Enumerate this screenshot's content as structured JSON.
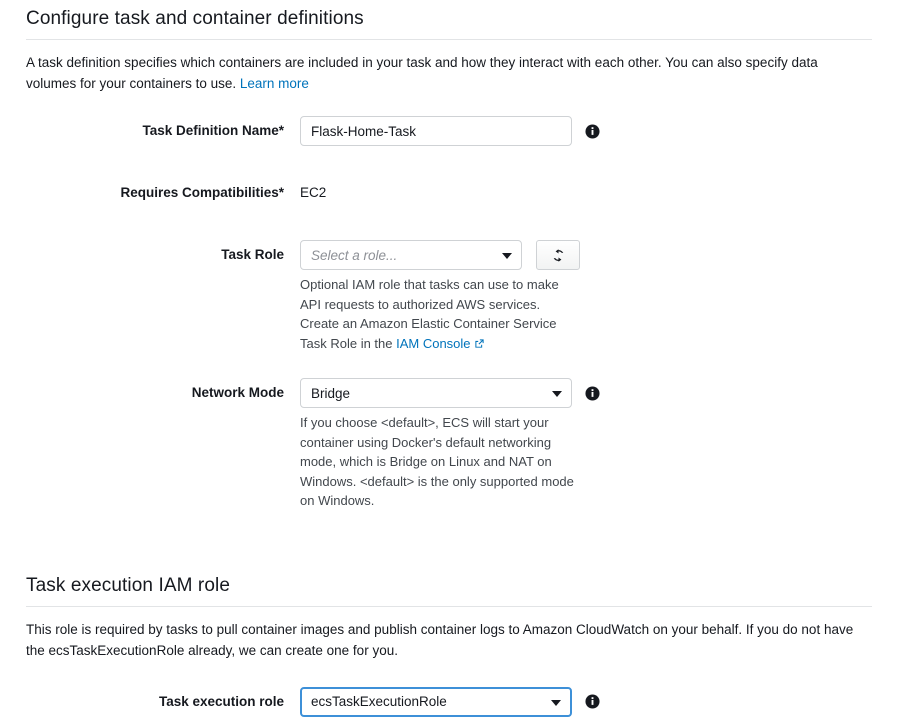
{
  "sections": [
    {
      "id": "configure",
      "title": "Configure task and container definitions",
      "description_before_link": "A task definition specifies which containers are included in your task and how they interact with each other. You can also specify data volumes for your containers to use. ",
      "link_label": "Learn more"
    },
    {
      "id": "execution-role",
      "title": "Task execution IAM role",
      "description": "This role is required by tasks to pull container images and publish container logs to Amazon CloudWatch on your behalf. If you do not have the ecsTaskExecutionRole already, we can create one for you."
    }
  ],
  "fields": {
    "task_definition_name": {
      "label": "Task Definition Name*",
      "value": "Flask-Home-Task",
      "placeholder": ""
    },
    "requires_compatibilities": {
      "label": "Requires Compatibilities*",
      "value": "EC2"
    },
    "task_role": {
      "label": "Task Role",
      "value": "Select a role...",
      "is_placeholder": true,
      "refresh_button_title": "Refresh",
      "help_text_before_link": "Optional IAM role that tasks can use to make API requests to authorized AWS services. Create an Amazon Elastic Container Service Task Role in the ",
      "help_link_label": "IAM Console"
    },
    "network_mode": {
      "label": "Network Mode",
      "value": "Bridge",
      "help_text": "If you choose <default>, ECS will start your container using Docker's default networking mode, which is Bridge on Linux and NAT on Windows. <default> is the only supported mode on Windows."
    },
    "task_execution_role": {
      "label": "Task execution role",
      "value": "ecsTaskExecutionRole",
      "focused": true
    }
  },
  "colors": {
    "link": "#0073bb",
    "focus_border": "#3d90d8",
    "text": "#16191f",
    "help_text": "#42474d",
    "border": "#cfd2d5"
  }
}
